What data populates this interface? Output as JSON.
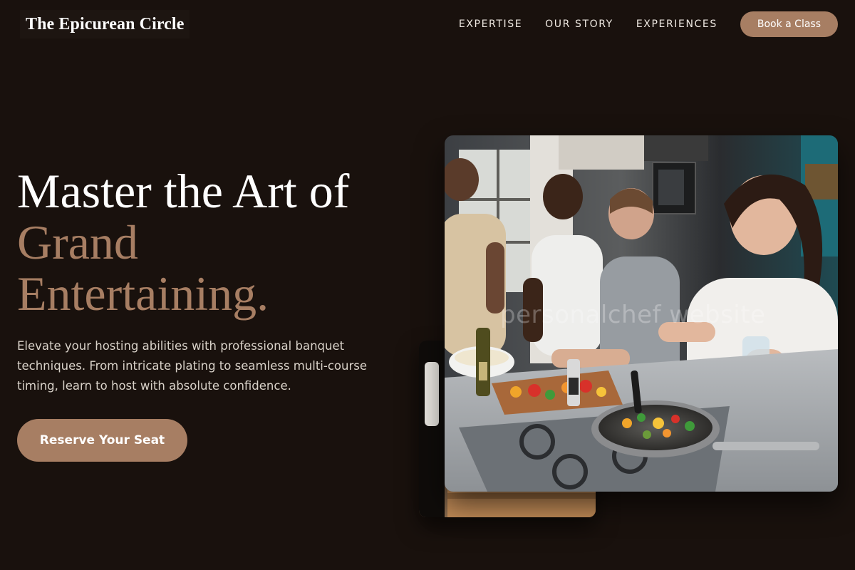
{
  "brand": {
    "name": "The Epicurean Circle"
  },
  "nav": {
    "links": [
      "EXPERTISE",
      "OUR STORY",
      "EXPERIENCES"
    ],
    "cta_label": "Book a Class"
  },
  "hero": {
    "title_line1": "Master the Art of",
    "title_line2": "Grand",
    "title_line3": "Entertaining.",
    "subtitle": "Elevate your hosting abilities with professional banquet techniques. From intricate plating to seamless multi-course timing, learn to host with absolute confidence.",
    "button_label": "Reserve Your Seat"
  },
  "images": {
    "main_watermark": "personalchef website",
    "main_alt": "People cooking together at a kitchen stove",
    "back_alt": "Kitchen cooking scene"
  },
  "colors": {
    "background": "#19110d",
    "accent": "#a77e63",
    "text": "#ffffff"
  }
}
